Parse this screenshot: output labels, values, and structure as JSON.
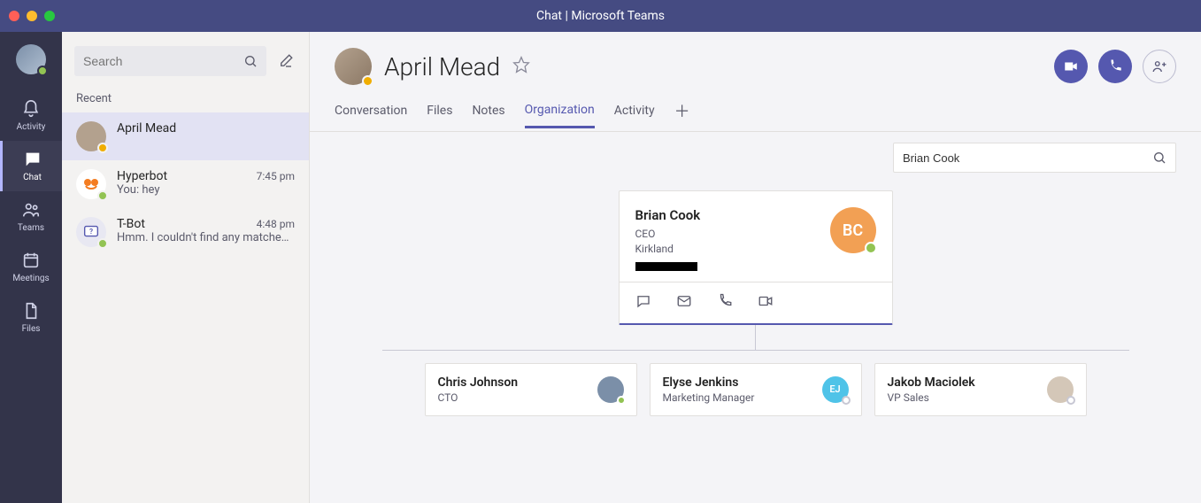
{
  "window": {
    "title": "Chat | Microsoft Teams"
  },
  "rail": {
    "items": [
      {
        "key": "activity",
        "label": "Activity"
      },
      {
        "key": "chat",
        "label": "Chat"
      },
      {
        "key": "teams",
        "label": "Teams"
      },
      {
        "key": "meetings",
        "label": "Meetings"
      },
      {
        "key": "files",
        "label": "Files"
      }
    ]
  },
  "chatlist": {
    "search_placeholder": "Search",
    "section_label": "Recent",
    "items": [
      {
        "name": "April Mead",
        "time": "",
        "preview": "",
        "selected": true,
        "avatar_bg": "#b3a18e",
        "status": "#f0ad00",
        "initials": ""
      },
      {
        "name": "Hyperbot",
        "time": "7:45 pm",
        "preview": "You: hey",
        "selected": false,
        "avatar_bg": "#ffffff",
        "status": "#92c353",
        "initials": ""
      },
      {
        "name": "T-Bot",
        "time": "4:48 pm",
        "preview": "Hmm. I couldn't find any matches. C…",
        "selected": false,
        "avatar_bg": "#e8e8f2",
        "status": "#92c353",
        "initials": ""
      }
    ]
  },
  "header": {
    "person_name": "April Mead",
    "tabs": [
      "Conversation",
      "Files",
      "Notes",
      "Organization",
      "Activity"
    ],
    "active_tab": "Organization"
  },
  "org": {
    "search_value": "Brian Cook",
    "card": {
      "name": "Brian Cook",
      "role": "CEO",
      "location": "Kirkland",
      "initials": "BC",
      "avatar_color": "#f2a054",
      "status_color": "#92c353"
    },
    "reports": [
      {
        "name": "Chris Johnson",
        "role": "CTO",
        "initials": "",
        "avatar_bg": "#7b8fa8",
        "status": "#92c353"
      },
      {
        "name": "Elyse Jenkins",
        "role": "Marketing Manager",
        "initials": "EJ",
        "avatar_bg": "#4fc3e8",
        "status": "#ffffff"
      },
      {
        "name": "Jakob Maciolek",
        "role": "VP Sales",
        "initials": "",
        "avatar_bg": "#d4c7b8",
        "status": "#ffffff"
      }
    ]
  }
}
